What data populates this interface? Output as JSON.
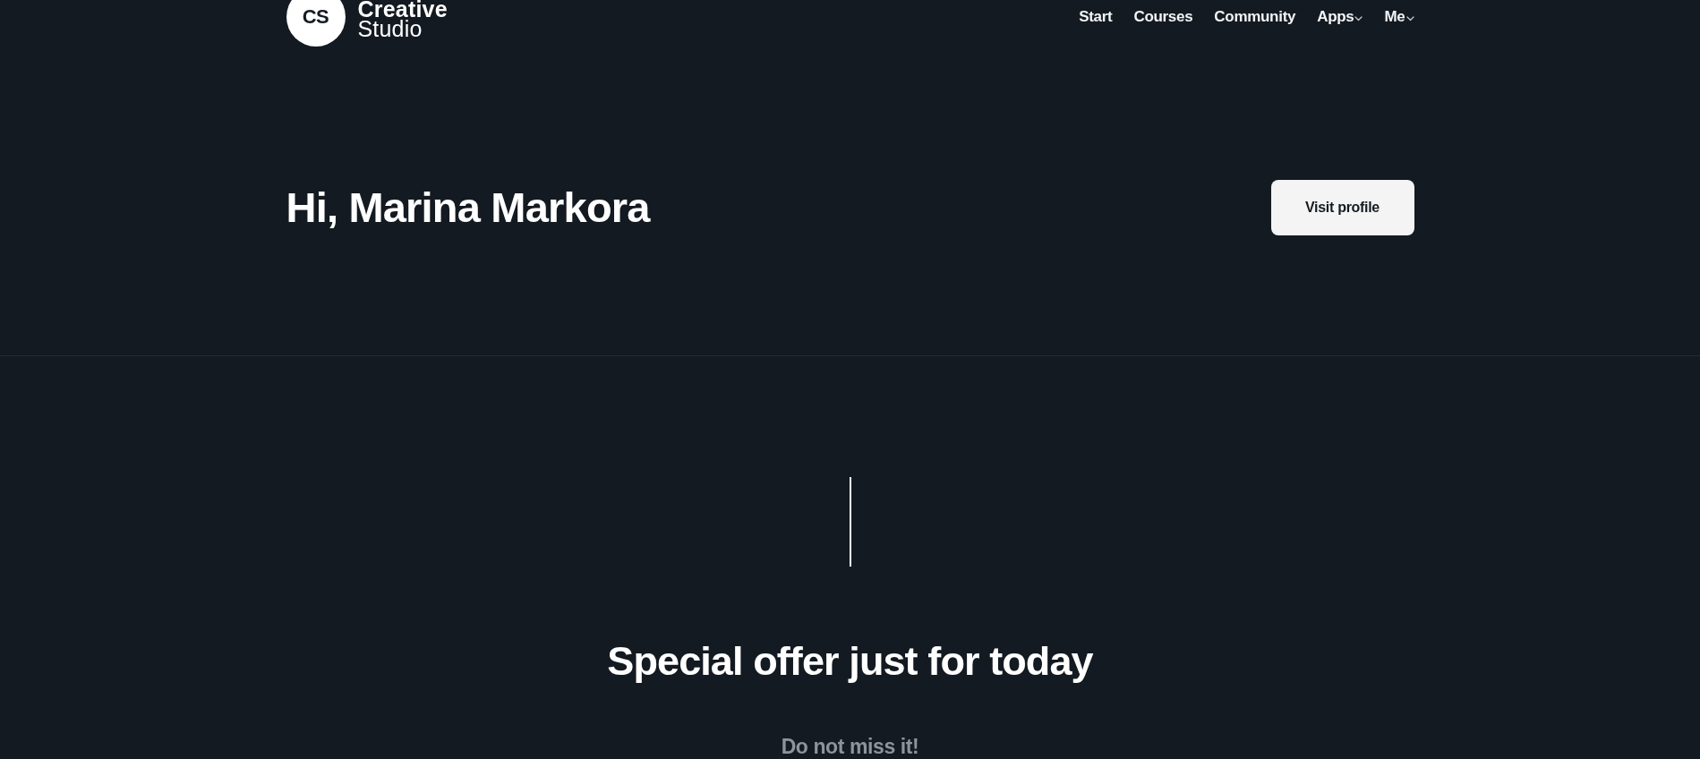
{
  "logo": {
    "initials": "CS",
    "name_line_1": "Creative",
    "name_line_2": "Studio"
  },
  "nav": [
    {
      "label": "Start",
      "dropdown": false
    },
    {
      "label": "Courses",
      "dropdown": false
    },
    {
      "label": "Community",
      "dropdown": false
    },
    {
      "label": "Apps",
      "dropdown": true
    },
    {
      "label": "Me",
      "dropdown": true
    }
  ],
  "hero": {
    "greeting": "Hi, Marina Markora",
    "button": "Visit profile"
  },
  "offer": {
    "title": "Special offer just for today",
    "subtitle": "Do not miss it!"
  }
}
